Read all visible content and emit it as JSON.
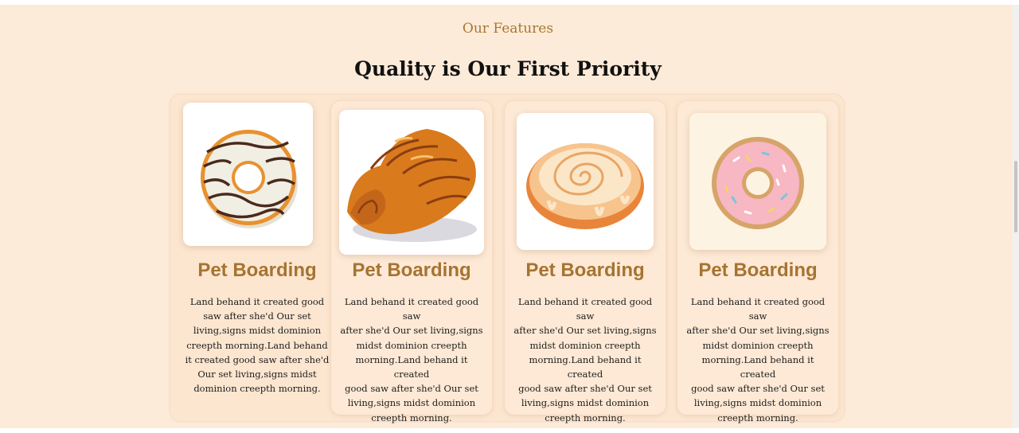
{
  "section": {
    "eyebrow": "Our Features",
    "heading": "Quality is Our First Priority"
  },
  "cards": [
    {
      "image": "chocolate-drizzle-donut",
      "title": "Pet Boarding",
      "lines": [
        "Land behand it created good",
        "saw after she'd Our set",
        "living,signs midst dominion",
        "creepth morning.Land behand",
        "it created good saw after she'd",
        "Our set living,signs midst",
        "dominion creepth morning."
      ]
    },
    {
      "image": "croissant",
      "title": "Pet Boarding",
      "lines": [
        "Land behand it created good saw",
        "after she'd Our set living,signs",
        "midst dominion creepth",
        "morning.Land behand it created",
        "good saw after she'd Our set",
        "living,signs midst dominion",
        "creepth morning."
      ]
    },
    {
      "image": "cinnamon-roll",
      "title": "Pet Boarding",
      "lines": [
        "Land behand it created good saw",
        "after she'd Our set living,signs",
        "midst dominion creepth",
        "morning.Land behand it created",
        "good saw after she'd Our set",
        "living,signs midst dominion",
        "creepth morning."
      ]
    },
    {
      "image": "pink-sprinkle-donut",
      "title": "Pet Boarding",
      "lines": [
        "Land behand it created good saw",
        "after she'd Our set living,signs",
        "midst dominion creepth",
        "morning.Land behand it created",
        "good saw after she'd Our set",
        "living,signs midst dominion",
        "creepth morning."
      ]
    }
  ],
  "colors": {
    "background": "#fdebd9",
    "accent": "#a67432",
    "heading": "#111111"
  }
}
